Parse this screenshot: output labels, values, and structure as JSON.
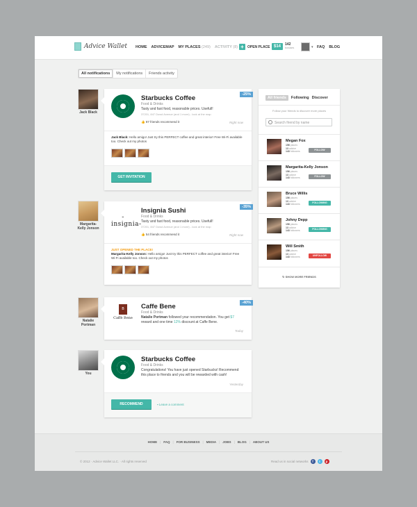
{
  "header": {
    "logo": "Advice Wallet",
    "nav": [
      {
        "label": "HOME"
      },
      {
        "label": "ADVICEMAP"
      },
      {
        "label": "MY PLACES",
        "count": "(249)"
      },
      {
        "label": "ACTIVITY",
        "count": "(8)"
      }
    ],
    "open_place": "OPEN PLACE",
    "wallet_amount": "$14",
    "bonuses_count": "142",
    "bonuses_label": "bonuses",
    "right_nav": [
      "FAQ",
      "BLOG"
    ]
  },
  "tabs": [
    "All notifications",
    "My notifications",
    "Friends activity"
  ],
  "feed": [
    {
      "person": "Jack Black",
      "title": "Starbucks Coffee",
      "category": "Food & Drinks",
      "discount": "-25%",
      "description": "Tasty and fast food, reasonable prices. Usefull!",
      "address": "37201, 847 Dowd Avenue (and 1 more) - look at the map",
      "recommend": "87 friends recommend it",
      "time": "Right now",
      "comment_author": "Jack Black:",
      "comment": "Hello amigo! Just try this PERFECT coffee and great interior! Free Wi-Fi available too. Check out my photos",
      "button": "GET INVITATION"
    },
    {
      "person": "Margarita-Kelly Jonson",
      "title": "Insignia Sushi",
      "category": "Food & Drinks",
      "discount": "-35%",
      "description": "Tasty and fast food, reasonable prices. Usefull!",
      "address": "37201, 847 Dowd Avenue (and 1 more) - look at the map",
      "recommend": "54 friends recommend it",
      "time": "Right now",
      "logo": "-insignia-",
      "badge": "JUST OPENED THE PLACE!",
      "comment_author": "Margarita-Kelly Jonson:",
      "comment": "Hello amigo! Just try this PERFECT coffee and great interior! Free Wi-Fi available too. Check out my photos"
    },
    {
      "person": "Natalie Portman",
      "title": "Caffe Bene",
      "category": "Food & Drinks",
      "discount": "-40%",
      "logo": "Caffè Bene",
      "text_author": "Natalie Portman",
      "text_1": "followed your recommendation. You get",
      "reward": "$7",
      "text_2": "reward and one time",
      "reward_pct": "12%",
      "text_3": "discount at Caffe Bene.",
      "time": "Today"
    },
    {
      "person": "You",
      "title": "Starbucks Coffee",
      "category": "Food & Drinks",
      "description": "Congratulations! You have just opened Starbucks! Recommend this place to friends and you will be rewarded with cash!",
      "time": "Yesterday",
      "button": "RECOMMEND",
      "link": "Leave a comment"
    }
  ],
  "sidebar": {
    "tabs": [
      "All friends",
      "Following",
      "Discover"
    ],
    "description": "Follow your friends to discover more places",
    "search_placeholder": "Search friend by name",
    "friends": [
      {
        "name": "Megan Fox",
        "places": "156",
        "advice": "13",
        "followers": "143",
        "action": "FOLLOW",
        "state": "follow"
      },
      {
        "name": "Margarita-Kelly Jonson",
        "places": "156",
        "advice": "13",
        "followers": "143",
        "action": "FOLLOW",
        "state": "follow"
      },
      {
        "name": "Bruce Willis",
        "places": "156",
        "advice": "13",
        "followers": "143",
        "action": "FOLLOWING",
        "state": "following"
      },
      {
        "name": "Johny Depp",
        "places": "156",
        "advice": "13",
        "followers": "143",
        "action": "FOLLOWING",
        "state": "following"
      },
      {
        "name": "Will Smith",
        "places": "156",
        "advice": "13",
        "followers": "143",
        "action": "UNFOLLOW",
        "state": "unfollow"
      }
    ],
    "labels": {
      "places": "places",
      "advice": "advice",
      "followers": "followers"
    },
    "show_more": "SHOW MORE FRIENDS"
  },
  "footer": {
    "nav": [
      "HOME",
      "FAQ",
      "FOR BUSINESS",
      "MEDIA",
      "JOBS",
      "BLOG",
      "ABOUT US"
    ],
    "copyright": "© 2012 · Advice Wallet LLC. · All rights reserved",
    "social_label": "Read us in social networks",
    "social": [
      "f",
      "t",
      "p"
    ]
  },
  "colors": {
    "accent": "#44b7a8",
    "discount": "#5aa2d3",
    "unfollow": "#e24743",
    "orange": "#f39c12"
  }
}
